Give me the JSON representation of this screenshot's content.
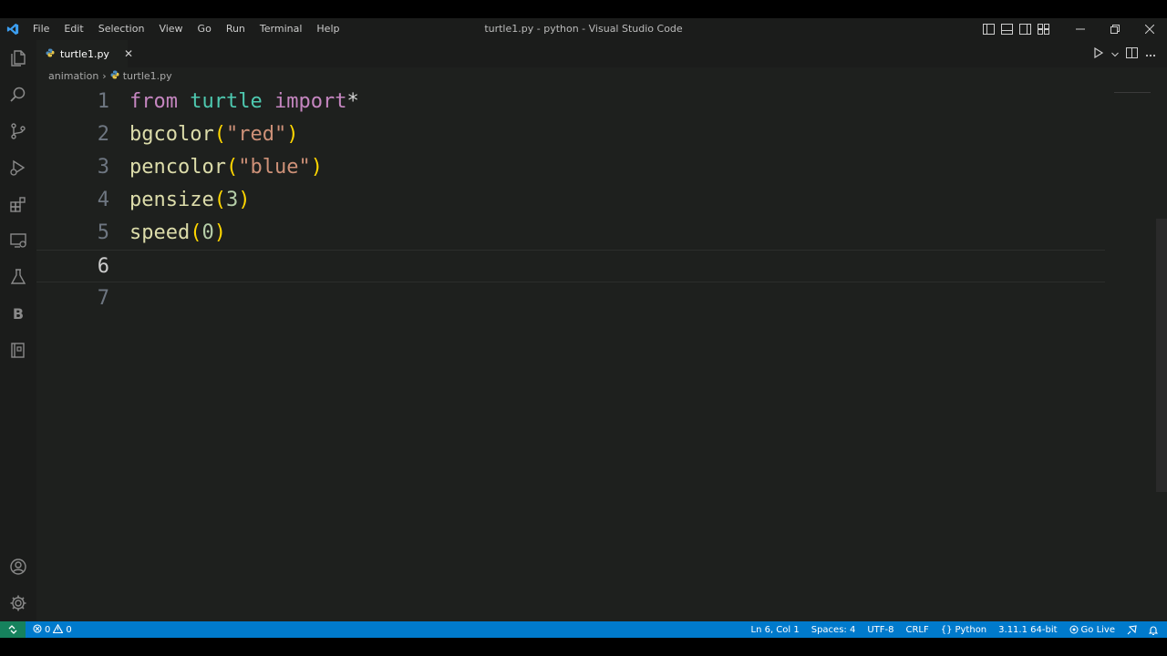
{
  "titlebar": {
    "menu": [
      "File",
      "Edit",
      "Selection",
      "View",
      "Go",
      "Run",
      "Terminal",
      "Help"
    ],
    "title": "turtle1.py - python - Visual Studio Code"
  },
  "tab": {
    "label": "turtle1.py",
    "close": "✕"
  },
  "breadcrumb": {
    "folder": "animation",
    "separator": "›",
    "file": "turtle1.py"
  },
  "editor": {
    "language": "python",
    "current_line": 6,
    "lines": [
      {
        "number": "1",
        "tokens": [
          {
            "t": "from",
            "c": "kw"
          },
          {
            "t": " ",
            "c": "op"
          },
          {
            "t": "turtle",
            "c": "mod"
          },
          {
            "t": " ",
            "c": "op"
          },
          {
            "t": "import",
            "c": "kw"
          },
          {
            "t": "*",
            "c": "op"
          }
        ]
      },
      {
        "number": "2",
        "tokens": [
          {
            "t": "bgcolor",
            "c": "fn"
          },
          {
            "t": "(",
            "c": "br"
          },
          {
            "t": "\"red\"",
            "c": "str"
          },
          {
            "t": ")",
            "c": "br"
          }
        ]
      },
      {
        "number": "3",
        "tokens": [
          {
            "t": "pencolor",
            "c": "fn"
          },
          {
            "t": "(",
            "c": "br"
          },
          {
            "t": "\"blue\"",
            "c": "str"
          },
          {
            "t": ")",
            "c": "br"
          }
        ]
      },
      {
        "number": "4",
        "tokens": [
          {
            "t": "pensize",
            "c": "fn"
          },
          {
            "t": "(",
            "c": "br"
          },
          {
            "t": "3",
            "c": "num"
          },
          {
            "t": ")",
            "c": "br"
          }
        ]
      },
      {
        "number": "5",
        "tokens": [
          {
            "t": "speed",
            "c": "fn"
          },
          {
            "t": "(",
            "c": "br"
          },
          {
            "t": "0",
            "c": "num"
          },
          {
            "t": ")",
            "c": "br"
          }
        ]
      },
      {
        "number": "6",
        "tokens": []
      },
      {
        "number": "7",
        "tokens": []
      }
    ]
  },
  "statusbar": {
    "errors": "0",
    "warnings": "0",
    "position": "Ln 6, Col 1",
    "spaces": "Spaces: 4",
    "encoding": "UTF-8",
    "eol": "CRLF",
    "language": "Python",
    "interpreter": "3.11.1 64-bit",
    "go_live": "Go Live"
  },
  "colors": {
    "accent": "#007acc",
    "remote": "#16825d",
    "keyword": "#c586c0",
    "module": "#4ec9b0",
    "function": "#dcdcaa",
    "string": "#ce9178",
    "number": "#b5cea8",
    "bracket": "#ffd700"
  },
  "icons": {
    "activitybar": [
      "files-icon",
      "search-icon",
      "source-control-icon",
      "run-debug-icon",
      "extensions-icon",
      "remote-explorer-icon",
      "testing-icon",
      "b-extension-icon",
      "notebook-icon",
      "account-icon",
      "settings-gear-icon"
    ]
  }
}
